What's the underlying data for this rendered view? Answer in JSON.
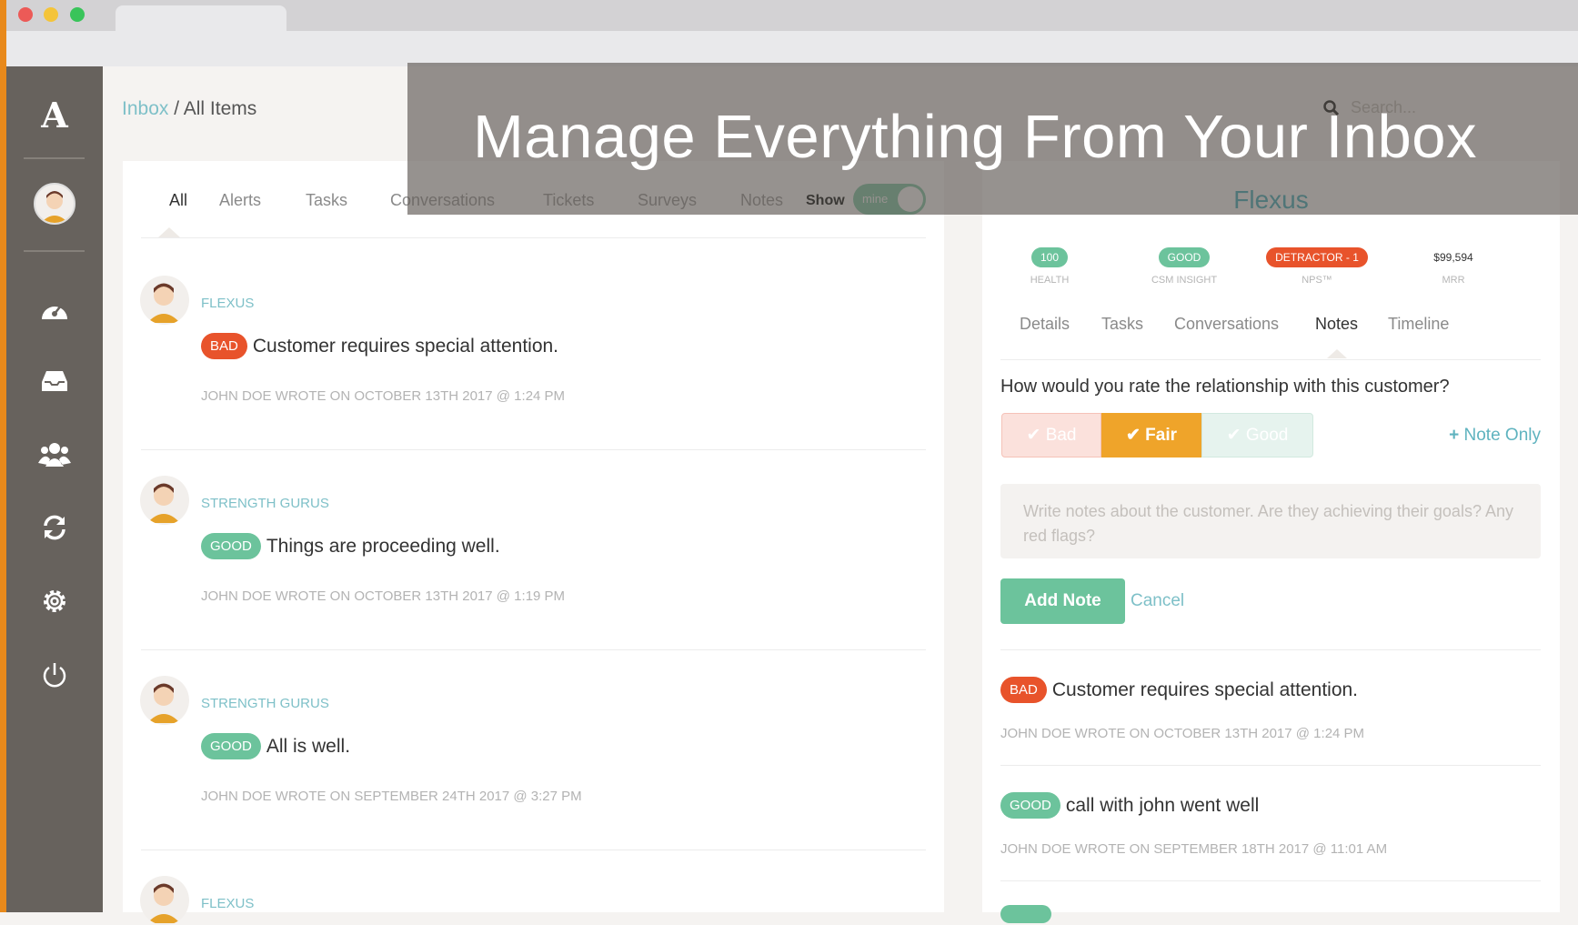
{
  "window": {
    "colors": {
      "close": "#ec5a57",
      "minimize": "#f4c43a",
      "maximize": "#39c45a",
      "accent": "#e8891b"
    }
  },
  "overlay": {
    "title": "Manage Everything From Your Inbox"
  },
  "search": {
    "placeholder": "Search..."
  },
  "sidebar": {
    "logo": "A",
    "items": [
      {
        "icon": "dashboard-icon"
      },
      {
        "icon": "inbox-icon"
      },
      {
        "icon": "users-icon"
      },
      {
        "icon": "refresh-icon"
      },
      {
        "icon": "gear-icon"
      },
      {
        "icon": "power-icon"
      }
    ]
  },
  "breadcrumb": {
    "root": "Inbox",
    "separator": "/",
    "current": "All Items"
  },
  "inbox": {
    "tabs": [
      "All",
      "Alerts",
      "Tasks",
      "Conversations",
      "Tickets",
      "Surveys",
      "Notes"
    ],
    "active_tab": "All",
    "show_label": "Show",
    "toggle_label": "mine",
    "items": [
      {
        "company": "FLEXUS",
        "badge": "BAD",
        "message": "Customer requires special attention.",
        "meta": "JOHN DOE WROTE ON OCTOBER 13TH 2017 @ 1:24 PM"
      },
      {
        "company": "STRENGTH GURUS",
        "badge": "GOOD",
        "message": "Things are proceeding well.",
        "meta": "JOHN DOE WROTE ON OCTOBER 13TH 2017 @ 1:19 PM"
      },
      {
        "company": "STRENGTH GURUS",
        "badge": "GOOD",
        "message": "All is well.",
        "meta": "JOHN DOE WROTE ON SEPTEMBER 24TH 2017 @ 3:27 PM"
      },
      {
        "company": "FLEXUS"
      }
    ]
  },
  "detail": {
    "company": "Flexus",
    "stats": [
      {
        "value": "100",
        "label": "HEALTH",
        "color": "#6cc39c"
      },
      {
        "value": "GOOD",
        "label": "CSM INSIGHT",
        "color": "#6cc39c"
      },
      {
        "value": "DETRACTOR - 1",
        "label": "NPS™",
        "color": "#e8532b"
      },
      {
        "value": "$99,594",
        "label": "MRR"
      }
    ],
    "tabs": [
      "Details",
      "Tasks",
      "Conversations",
      "Notes",
      "Timeline"
    ],
    "active_tab": "Notes",
    "question": "How would you rate the relationship with this customer?",
    "ratings": [
      {
        "label": "Bad",
        "selected": false
      },
      {
        "label": "Fair",
        "selected": true
      },
      {
        "label": "Good",
        "selected": false
      }
    ],
    "note_only": "Note Only",
    "textarea_placeholder": "Write notes about the customer. Are they achieving their goals? Any red flags?",
    "add_note": "Add Note",
    "cancel": "Cancel",
    "notes": [
      {
        "badge": "BAD",
        "message": "Customer requires special attention.",
        "meta": "JOHN DOE WROTE ON OCTOBER 13TH 2017 @ 1:24 PM"
      },
      {
        "badge": "GOOD",
        "message": "call with john went well",
        "meta": "JOHN DOE WROTE ON SEPTEMBER 18TH 2017 @ 11:01 AM"
      }
    ]
  }
}
